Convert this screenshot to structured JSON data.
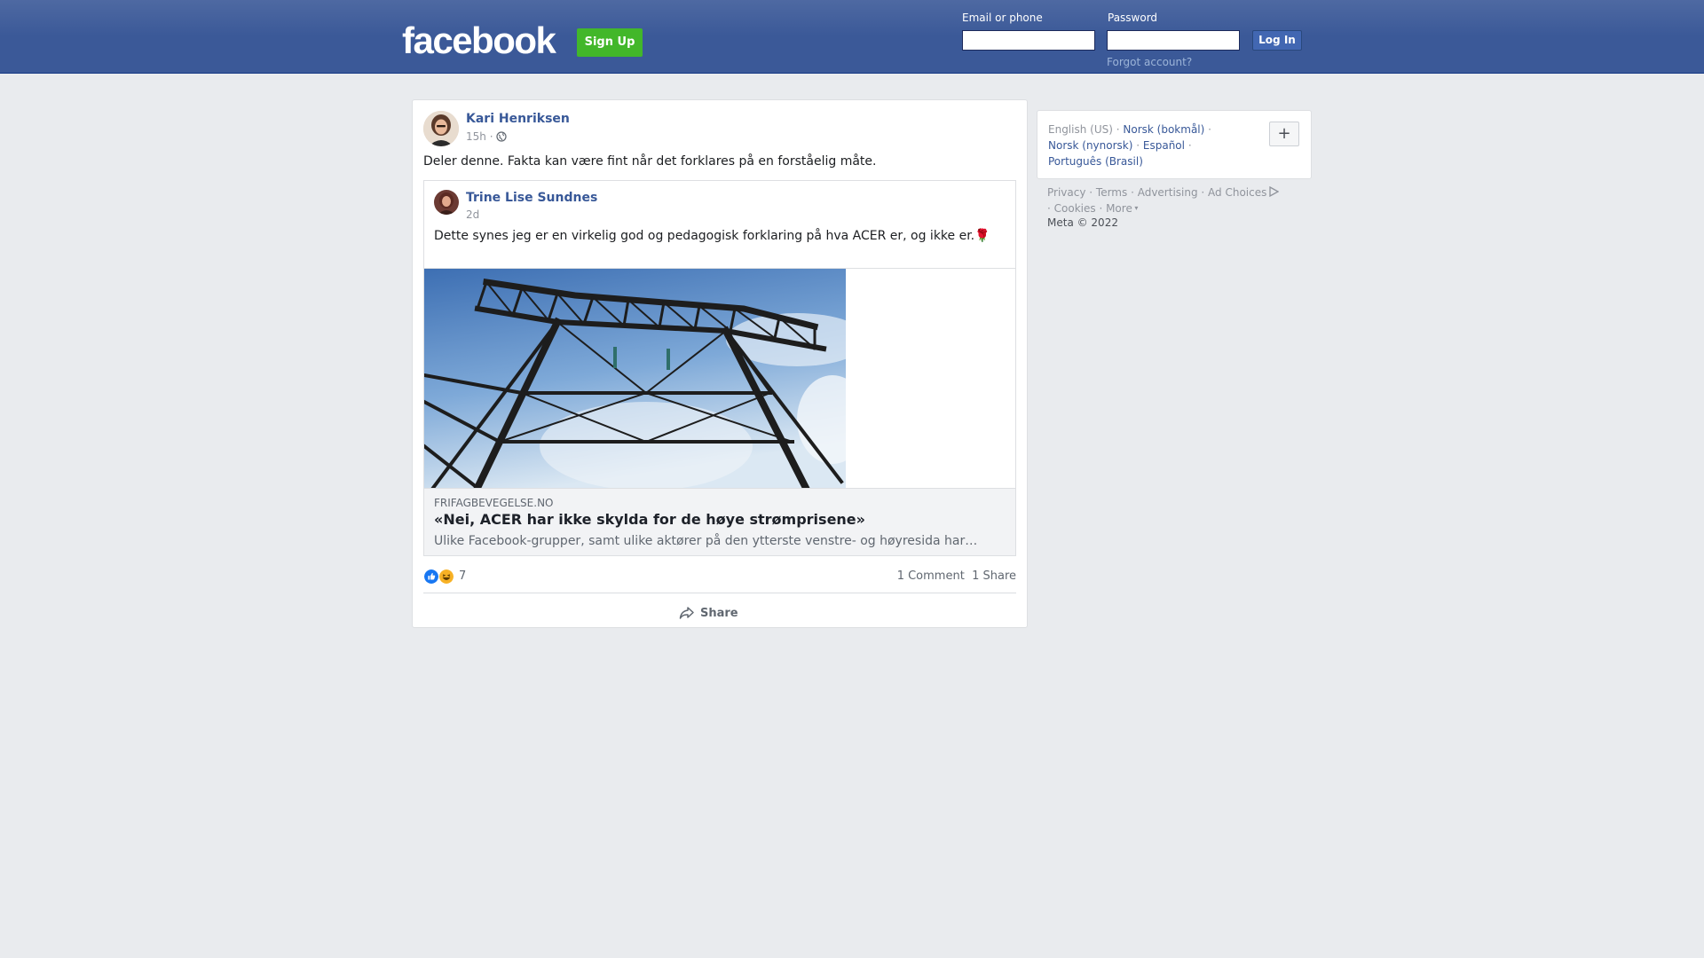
{
  "header": {
    "logo": "facebook",
    "signup_label": "Sign Up",
    "email_label": "Email or phone",
    "email_value": "",
    "password_label": "Password",
    "password_value": "",
    "login_label": "Log In",
    "forgot_label": "Forgot account?"
  },
  "post": {
    "author": "Kari Henriksen",
    "time": "15h",
    "separator": "·",
    "privacy_icon": "globe-icon",
    "text": "Deler denne. Fakta kan være fint når det forklares på en forståelig måte.",
    "shared": {
      "author": "Trine Lise Sundnes",
      "time": "2d",
      "text": "Dette synes jeg er en virkelig god og pedagogisk forklaring på hva ACER er, og ikke er.",
      "emoji": "🌹",
      "link": {
        "domain": "FRIFAGBEVEGELSE.NO",
        "title": "«Nei, ACER har ikke skylda for de høye strømprisene»",
        "description": "Ulike Facebook-grupper, samt ulike aktører på den ytterste venstre- og høyresida har…"
      }
    },
    "reaction_count": "7",
    "comments": "1 Comment",
    "shares": "1 Share",
    "share_label": "Share"
  },
  "sidebar": {
    "current_language": "English (US)",
    "languages": [
      "Norsk (bokmål)",
      "Norsk (nynorsk)",
      "Español",
      "Português (Brasil)"
    ],
    "plus_label": "+",
    "footer_links": [
      "Privacy",
      "Terms",
      "Advertising",
      "Ad Choices",
      "Cookies",
      "More"
    ],
    "copyright": "Meta © 2022"
  },
  "colors": {
    "brand_blue": "#3b5998",
    "signup_green": "#42b72a",
    "link_blue": "#385898"
  }
}
